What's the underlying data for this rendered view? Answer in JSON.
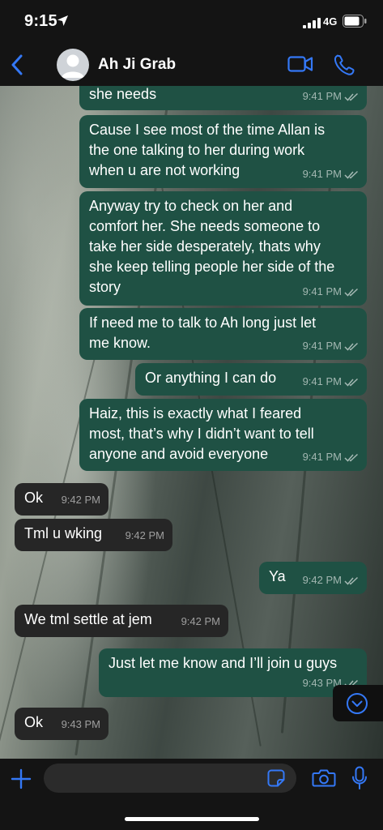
{
  "status_bar": {
    "time": "9:15",
    "network": "4G"
  },
  "header": {
    "contact_name": "Ah Ji Grab"
  },
  "messages": [
    {
      "dir": "out",
      "lines": [
        "she needs"
      ],
      "time": "9:41 PM",
      "read": true
    },
    {
      "dir": "out",
      "lines": [
        "Cause I see most of the time Allan is",
        "the one talking to her during work",
        "when u are not working"
      ],
      "time": "9:41 PM",
      "read": true
    },
    {
      "dir": "out",
      "lines": [
        "Anyway try to check on her and",
        "comfort her. She needs someone to",
        "take her side desperately, thats why",
        "she keep telling people her side of the",
        "story"
      ],
      "time": "9:41 PM",
      "read": true
    },
    {
      "dir": "out",
      "lines": [
        "If need me to talk to Ah long just let",
        "me know."
      ],
      "time": "9:41 PM",
      "read": true
    },
    {
      "dir": "out",
      "lines": [
        "Or anything I can do"
      ],
      "time": "9:41 PM",
      "read": true
    },
    {
      "dir": "out",
      "lines": [
        "Haiz, this is exactly what I feared",
        "most, that’s why I didn’t want to tell",
        "anyone and avoid everyone"
      ],
      "time": "9:41 PM",
      "read": true
    },
    {
      "dir": "in",
      "lines": [
        "Ok"
      ],
      "time": "9:42 PM"
    },
    {
      "dir": "in",
      "lines": [
        "Tml u wking"
      ],
      "time": "9:42 PM"
    },
    {
      "dir": "out",
      "lines": [
        "Ya"
      ],
      "time": "9:42 PM",
      "read": true
    },
    {
      "dir": "in",
      "lines": [
        "We tml settle at jem"
      ],
      "time": "9:42 PM"
    },
    {
      "dir": "out",
      "lines": [
        "Just let me know and I’ll join u guys"
      ],
      "time": "9:43 PM",
      "read": true
    },
    {
      "dir": "in",
      "lines": [
        "Ok"
      ],
      "time": "9:43 PM"
    }
  ],
  "composer": {
    "value": ""
  },
  "colors": {
    "accent": "#3478f6",
    "outgoing_bubble": "#1f5144",
    "incoming_bubble": "#262626",
    "bar_background": "#141414"
  }
}
